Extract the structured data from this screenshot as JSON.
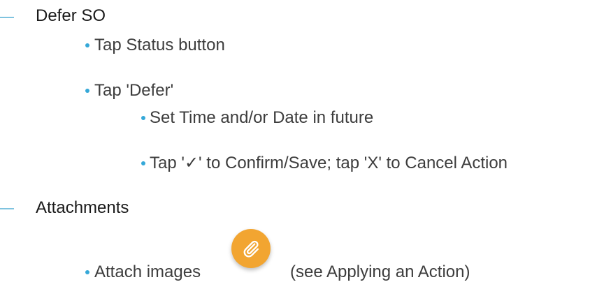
{
  "sections": [
    {
      "heading": "Defer SO",
      "items": [
        {
          "text": "Tap Status button"
        },
        {
          "text": "Tap 'Defer'",
          "subitems": [
            {
              "text": "Set Time and/or Date in future"
            },
            {
              "text": "Tap '✓' to Confirm/Save; tap 'X' to Cancel Action"
            }
          ]
        }
      ]
    },
    {
      "heading": "Attachments",
      "items": [
        {
          "text": "Attach images",
          "suffix": "(see Applying an Action)",
          "icon": "paperclip-icon"
        }
      ]
    }
  ],
  "colors": {
    "bullet": "#35a8d8",
    "dash": "#7fc3df",
    "fab": "#f2a531"
  }
}
